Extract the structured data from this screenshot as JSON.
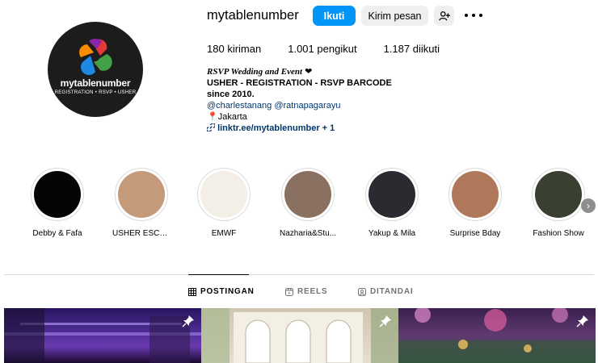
{
  "profile": {
    "username": "mytablenumber",
    "avatar_logo_text": "mytablenumber",
    "avatar_logo_sub": "REGISTRATION • RSVP • USHER",
    "follow_label": "Ikuti",
    "message_label": "Kirim pesan",
    "suggest_icon": "person-add-icon",
    "more_icon": "more-options-icon"
  },
  "stats": {
    "posts": "180",
    "posts_label": "kiriman",
    "followers": "1.001",
    "followers_label": "pengikut",
    "following": "1.187",
    "following_label": "diikuti"
  },
  "bio": {
    "title": "RSVP Wedding and Event",
    "heart": "❤",
    "line2": "USHER - REGISTRATION - RSVP BARCODE",
    "line3": "since 2010.",
    "tags": "@charlestanang @ratnapagarayu",
    "location_pin": "📍",
    "location": "Jakarta",
    "link": "linktr.ee/mytablenumber",
    "link_more": "+ 1"
  },
  "highlights": [
    {
      "label": "Debby & Fafa",
      "color": "#050505"
    },
    {
      "label": "USHER ESCORT",
      "color": "#c49a7a"
    },
    {
      "label": "EMWF",
      "color": "#f3efe6"
    },
    {
      "label": "Nazharia&Stu...",
      "color": "#8a7060"
    },
    {
      "label": "Yakup & Mila",
      "color": "#2a2a30"
    },
    {
      "label": "Surprise Bday",
      "color": "#b0785a"
    },
    {
      "label": "Fashion Show",
      "color": "#3a4030"
    }
  ],
  "tabs": {
    "posts": "POSTINGAN",
    "reels": "REELS",
    "tagged": "DITANDAI"
  },
  "posts": [
    {
      "name": "post-1",
      "color": "#3b1a6e"
    },
    {
      "name": "post-2",
      "color": "#d9d2c0"
    },
    {
      "name": "post-3",
      "color": "#5a3a70"
    }
  ],
  "colors": {
    "accent": "#0095f6",
    "secondary_button": "#efefef",
    "link": "#00376b"
  }
}
